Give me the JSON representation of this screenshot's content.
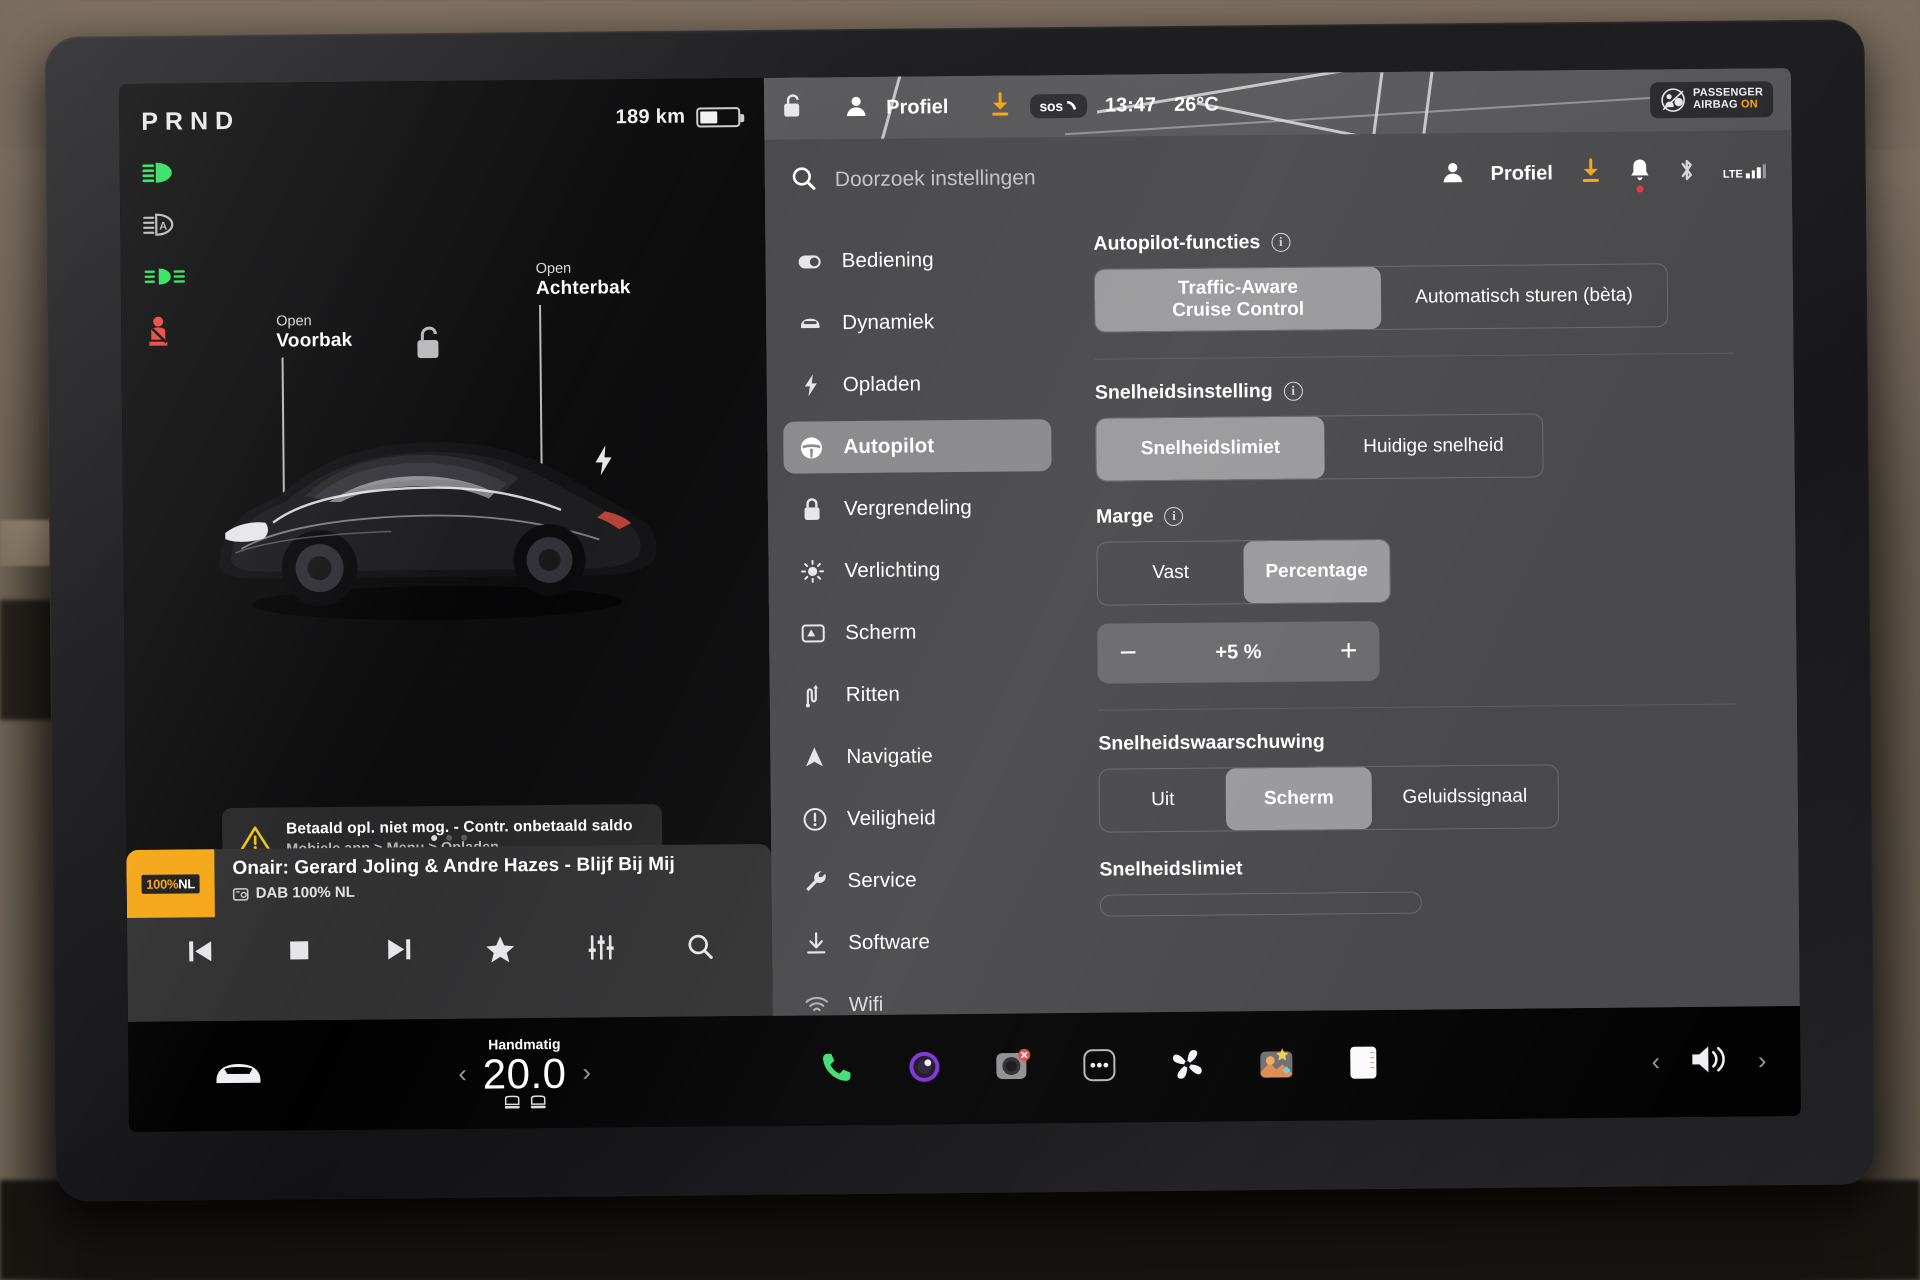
{
  "drive": {
    "gear_indicator": "PRND",
    "range_text": "189 km",
    "battery_percent": 48,
    "telltales": [
      {
        "name": "high-beam-icon",
        "color": "#2ee05a"
      },
      {
        "name": "auto-high-beam-icon",
        "color": "#b9b9bb"
      },
      {
        "name": "fog-light-icon",
        "color": "#2ee05a"
      },
      {
        "name": "seatbelt-warning-icon",
        "color": "#e8463c"
      }
    ],
    "callouts": [
      {
        "name": "front-trunk",
        "action": "Open",
        "label": "Voorbak"
      },
      {
        "name": "rear-trunk",
        "action": "Open",
        "label": "Achterbak"
      }
    ],
    "warning": {
      "title": "Betaald opl. niet mog. - Contr. onbetaald saldo",
      "subtitle": "Mobiele app > Menu > Opladen",
      "icon": "warning-triangle-icon",
      "color": "#f0c419"
    }
  },
  "media": {
    "album_badge": "100%",
    "album_badge_suffix": "NL",
    "track_title": "Onair: Gerard Joling & Andre Hazes - Blijf Bij Mij",
    "source": "DAB 100% NL",
    "controls": [
      {
        "name": "previous-track-button",
        "icon": "skip-back-icon"
      },
      {
        "name": "stop-button",
        "icon": "stop-icon"
      },
      {
        "name": "next-track-button",
        "icon": "skip-forward-icon"
      },
      {
        "name": "favorite-button",
        "icon": "star-icon"
      },
      {
        "name": "equalizer-button",
        "icon": "sliders-icon"
      },
      {
        "name": "search-media-button",
        "icon": "search-icon"
      }
    ],
    "page_dots": 3,
    "active_dot": 0
  },
  "top_status": {
    "lock_icon": "unlocked-padlock-icon",
    "profile_label": "Profiel",
    "download_icon": "download-arrow-icon",
    "download_color": "#f5a615",
    "sos_label": "sos",
    "clock": "13:47",
    "temperature": "26°C",
    "airbag": {
      "line1": "PASSENGER",
      "line2_prefix": "AIRBAG",
      "line2_status": "ON",
      "status_color": "#f5a615",
      "icon": "passenger-airbag-icon"
    }
  },
  "settings": {
    "search": {
      "placeholder": "Doorzoek instellingen",
      "value": "",
      "icon": "search-icon"
    },
    "header_right": {
      "profile_label": "Profiel",
      "icons": [
        {
          "name": "download-arrow-icon",
          "color": "#f5a615"
        },
        {
          "name": "notification-bell-icon",
          "badge": true
        },
        {
          "name": "bluetooth-icon"
        },
        {
          "name": "lte-signal-icon",
          "label": "LTE"
        }
      ]
    },
    "sidebar": {
      "items": [
        {
          "label": "Bediening",
          "icon": "toggle-switch-icon",
          "active": false
        },
        {
          "label": "Dynamiek",
          "icon": "car-front-icon",
          "active": false
        },
        {
          "label": "Opladen",
          "icon": "lightning-bolt-icon",
          "active": false
        },
        {
          "label": "Autopilot",
          "icon": "steering-wheel-icon",
          "active": true
        },
        {
          "label": "Vergrendeling",
          "icon": "lock-icon",
          "active": false
        },
        {
          "label": "Verlichting",
          "icon": "sun-brightness-icon",
          "active": false
        },
        {
          "label": "Scherm",
          "icon": "display-icon",
          "active": false
        },
        {
          "label": "Ritten",
          "icon": "route-icon",
          "active": false
        },
        {
          "label": "Navigatie",
          "icon": "navigation-arrow-icon",
          "active": false
        },
        {
          "label": "Veiligheid",
          "icon": "exclamation-circle-icon",
          "active": false
        },
        {
          "label": "Service",
          "icon": "wrench-icon",
          "active": false
        },
        {
          "label": "Software",
          "icon": "download-icon",
          "active": false
        },
        {
          "label": "Wifi",
          "icon": "wifi-icon",
          "active": false
        }
      ]
    },
    "sections": [
      {
        "title": "Autopilot-functies",
        "has_info": true,
        "options": [
          {
            "label": "Traffic-Aware\nCruise Control",
            "selected": true
          },
          {
            "label": "Automatisch sturen (bèta)",
            "selected": false
          }
        ]
      },
      {
        "title": "Snelheidsinstelling",
        "has_info": true,
        "options": [
          {
            "label": "Snelheidslimiet",
            "selected": true
          },
          {
            "label": "Huidige snelheid",
            "selected": false
          }
        ]
      },
      {
        "title": "Marge",
        "has_info": true,
        "options": [
          {
            "label": "Vast",
            "selected": false
          },
          {
            "label": "Percentage",
            "selected": true
          }
        ],
        "stepper": {
          "value": "+5 %",
          "minus_label": "−",
          "plus_label": "+"
        }
      },
      {
        "title": "Snelheidswaarschuwing",
        "has_info": false,
        "options": [
          {
            "label": "Uit",
            "selected": false
          },
          {
            "label": "Scherm",
            "selected": true
          },
          {
            "label": "Geluidssignaal",
            "selected": false
          }
        ]
      },
      {
        "title": "Snelheidslimiet",
        "has_info": false,
        "options": []
      }
    ]
  },
  "bottom_bar": {
    "car_icon": "car-front-icon",
    "climate": {
      "mode": "Handmatig",
      "temperature": "20.0",
      "left_arrow": "‹",
      "right_arrow": "›",
      "seat_icons": [
        "heated-seat-driver-icon",
        "heated-seat-passenger-icon"
      ]
    },
    "apps": [
      {
        "name": "phone-app",
        "icon": "phone-icon",
        "color": "#3ddc72"
      },
      {
        "name": "camera-app",
        "icon": "lens-purple-icon"
      },
      {
        "name": "dashcam-app",
        "icon": "dashcam-icon",
        "badge": true
      },
      {
        "name": "more-apps",
        "icon": "ellipsis-icon"
      },
      {
        "name": "fan-app",
        "icon": "fan-icon"
      },
      {
        "name": "gallery-app",
        "icon": "photos-icon"
      },
      {
        "name": "notes-app",
        "icon": "card-icon"
      }
    ],
    "volume": {
      "left_arrow": "‹",
      "icon": "speaker-icon",
      "right_arrow": "›"
    }
  }
}
